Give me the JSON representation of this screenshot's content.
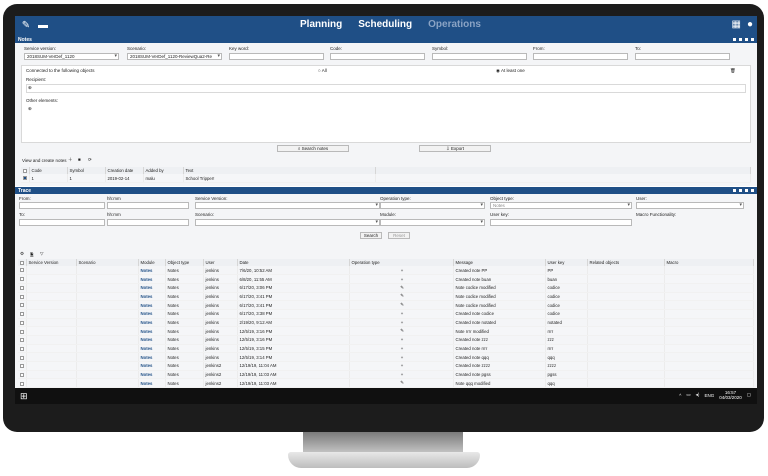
{
  "nav": {
    "tabs": [
      "Planning",
      "Scheduling",
      "Operations"
    ],
    "active": "Scheduling"
  },
  "notes_panel": {
    "title": "Notes",
    "service_version_label": "Service version:",
    "service_version_value": "2018SUM-VerDef_1120",
    "scenario_label": "Scenario:",
    "scenario_value": "2018SUM-VerDef_1120-ReviewQua2-Re",
    "keyword_label": "Key word:",
    "code_label": "Code:",
    "symbol_label": "Symbol:",
    "from_label": "From:",
    "to_label": "To:",
    "connected_label": "Connected to the following objects",
    "all_label": "All",
    "at_least_one_label": "At least one",
    "recipient_label": "Recipient:",
    "other_elements_label": "Other elements:",
    "search_button": "Search notes",
    "export_button": "Export",
    "view_create_label": "View and create notes",
    "grid_headers": [
      "Code",
      "Symbol",
      "Creation date",
      "Added by",
      "Text"
    ],
    "rows": [
      {
        "code": "1",
        "symbol": "1",
        "date": "2019-02-14",
        "added_by": "malu",
        "text": "School Tripper!"
      }
    ]
  },
  "trace_panel": {
    "title": "Trace",
    "from_label": "From:",
    "hhmm_label": "hh:mm",
    "service_version_label": "Service Version:",
    "operation_type_label": "Operation type:",
    "object_type_label": "Object type:",
    "object_type_value": "Notes",
    "user_label": "User:",
    "to_label": "To:",
    "scenario_label": "Scenario:",
    "module_label": "Module:",
    "user_key_label": "User key:",
    "macro_label": "Macro Functionality:",
    "search_button": "Search",
    "reset_button": "Reset",
    "grid_headers": [
      "Service Version",
      "Scenario",
      "Module",
      "Object type",
      "User",
      "Date",
      "Operation type",
      "Message",
      "User key",
      "Related objects",
      "Macro"
    ],
    "rows": [
      {
        "module": "Notes",
        "object": "Notes",
        "user": "jenkins",
        "date": "7/6/20, 10:52 AM",
        "op": "+",
        "message": "Created note PP",
        "key": "PP"
      },
      {
        "module": "Notes",
        "object": "Notes",
        "user": "jenkins",
        "date": "6/8/20, 11:55 AM",
        "op": "+",
        "message": "Created note buan",
        "key": "buan"
      },
      {
        "module": "Notes",
        "object": "Notes",
        "user": "jenkins",
        "date": "6/17/20, 3:06 PM",
        "op": "✎",
        "message": "Note codice modified",
        "key": "codice"
      },
      {
        "module": "Notes",
        "object": "Notes",
        "user": "jenkins",
        "date": "6/17/20, 3:41 PM",
        "op": "✎",
        "message": "Note codice modified",
        "key": "codice"
      },
      {
        "module": "Notes",
        "object": "Notes",
        "user": "jenkins",
        "date": "6/17/20, 3:41 PM",
        "op": "✎",
        "message": "Note codice modified",
        "key": "codice"
      },
      {
        "module": "Notes",
        "object": "Notes",
        "user": "jenkins",
        "date": "6/17/20, 3:38 PM",
        "op": "+",
        "message": "Created note codice",
        "key": "codice"
      },
      {
        "module": "Notes",
        "object": "Notes",
        "user": "jenkins",
        "date": "2/19/20, 9:12 AM",
        "op": "+",
        "message": "Created note notated",
        "key": "notated"
      },
      {
        "module": "Notes",
        "object": "Notes",
        "user": "jenkins",
        "date": "12/5/19, 3:16 PM",
        "op": "✎",
        "message": "Note rrrr modified",
        "key": "rrrr"
      },
      {
        "module": "Notes",
        "object": "Notes",
        "user": "jenkins",
        "date": "12/5/19, 3:16 PM",
        "op": "+",
        "message": "Created note zzz",
        "key": "zzz"
      },
      {
        "module": "Notes",
        "object": "Notes",
        "user": "jenkins",
        "date": "12/5/19, 3:15 PM",
        "op": "+",
        "message": "Created note rrrr",
        "key": "rrrr"
      },
      {
        "module": "Notes",
        "object": "Notes",
        "user": "jenkins",
        "date": "12/5/19, 3:14 PM",
        "op": "+",
        "message": "Created note qqq",
        "key": "qqq"
      },
      {
        "module": "Notes",
        "object": "Notes",
        "user": "jenkins2",
        "date": "12/19/19, 11:04 AM",
        "op": "+",
        "message": "Created note zzzz",
        "key": "zzzz"
      },
      {
        "module": "Notes",
        "object": "Notes",
        "user": "jenkins2",
        "date": "12/19/19, 11:03 AM",
        "op": "+",
        "message": "Created note pgss",
        "key": "pgss"
      },
      {
        "module": "Notes",
        "object": "Notes",
        "user": "jenkins2",
        "date": "12/19/19, 11:03 AM",
        "op": "✎",
        "message": "Note qqq modified",
        "key": "qqq"
      }
    ]
  },
  "taskbar": {
    "lang": "ENG",
    "time": "16:57",
    "date": "04/03/2020"
  }
}
